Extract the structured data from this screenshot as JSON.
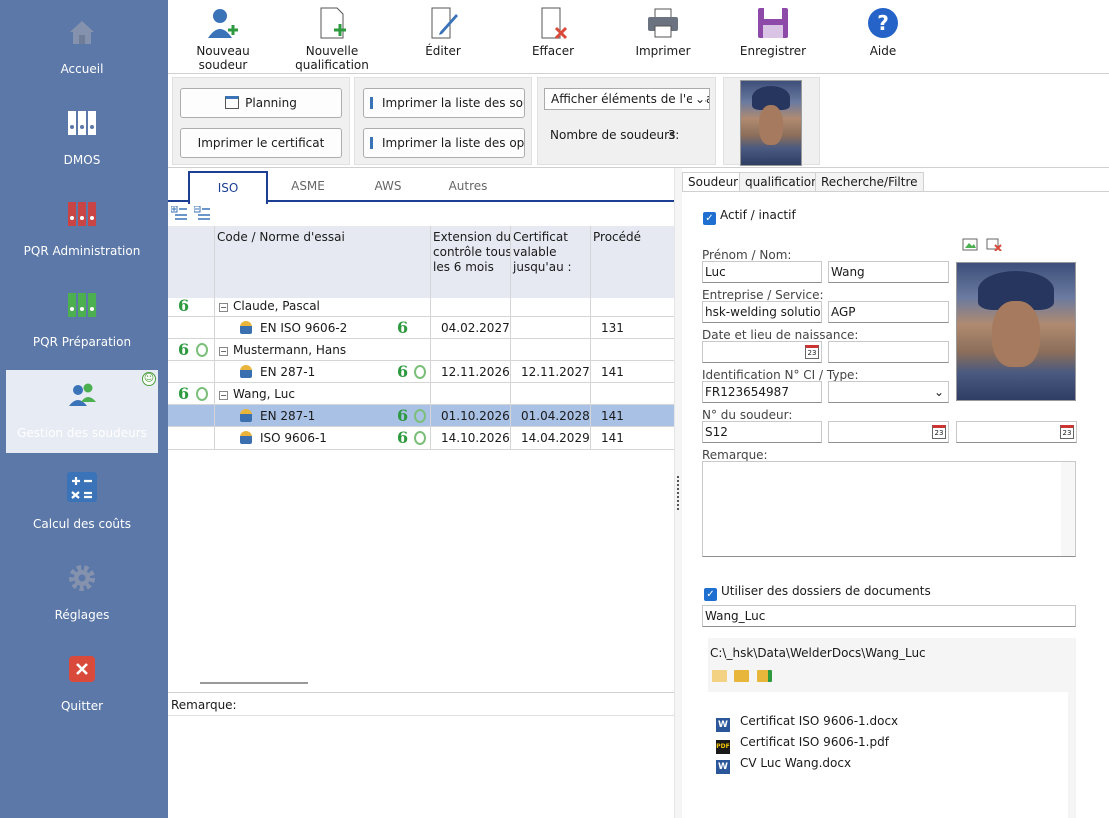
{
  "sidebar": {
    "items": [
      {
        "label": "Accueil",
        "icon": "home-icon"
      },
      {
        "label": "DMOS",
        "icon": "binders-icon"
      },
      {
        "label": "PQR Administration",
        "icon": "binders-red-icon"
      },
      {
        "label": "PQR Préparation",
        "icon": "binders-green-icon"
      },
      {
        "label": "Gestion des soudeurs",
        "icon": "welders-icon"
      },
      {
        "label": "Calcul des coûts",
        "icon": "calculator-icon"
      },
      {
        "label": "Réglages",
        "icon": "gear-icon"
      },
      {
        "label": "Quitter",
        "icon": "close-icon"
      }
    ],
    "smiley": "☺"
  },
  "toolbar": {
    "new_welder": "Nouveau soudeur",
    "new_qual_1": "Nouvelle",
    "new_qual_2": "qualification",
    "edit": "Éditer",
    "delete": "Effacer",
    "print": "Imprimer",
    "save": "Enregistrer",
    "help": "Aide"
  },
  "subbar": {
    "planning": "Planning",
    "print_certificate": "Imprimer le certificat",
    "print_welder_list": "Imprimer la liste des soudeurs",
    "print_operator_list": "Imprimer la liste des opérateurs",
    "show_elements": "Afficher éléments de l'essai",
    "welder_count_label": "Nombre de soudeurs:",
    "welder_count": "3"
  },
  "tabs": [
    "ISO",
    "ASME",
    "AWS",
    "Autres"
  ],
  "table": {
    "headers": {
      "code": "Code / Norme d'essai",
      "ext_1": "Extension du",
      "ext_2": "contrôle tous",
      "ext_3": "les 6 mois",
      "cert_1": "Certificat",
      "cert_2": "valable",
      "cert_3": "jusqu'au :",
      "process": "Procédé"
    },
    "six": "6",
    "groups": [
      {
        "name": "Claude, Pascal",
        "rows": [
          {
            "code": "EN ISO 9606-2",
            "ext": "04.02.2027",
            "cert": "",
            "proc": "131"
          }
        ]
      },
      {
        "name": "Mustermann, Hans",
        "rows": [
          {
            "code": "EN 287-1",
            "ext": "12.11.2026",
            "cert": "12.11.2027",
            "proc": "141"
          }
        ]
      },
      {
        "name": "Wang, Luc",
        "rows": [
          {
            "code": "EN 287-1",
            "ext": "01.10.2026",
            "cert": "01.04.2028",
            "proc": "141"
          },
          {
            "code": "ISO 9606-1",
            "ext": "14.10.2026",
            "cert": "14.04.2029",
            "proc": "141"
          }
        ]
      }
    ]
  },
  "left_remark_label": "Remarque:",
  "right": {
    "tabs": [
      "Soudeur",
      "qualification",
      "Recherche/Filtre"
    ],
    "active_label": "Actif / inactif",
    "name_label": "Prénom / Nom:",
    "first_name": "Luc",
    "last_name": "Wang",
    "company_label": "Entreprise / Service:",
    "company": "hsk-welding solutions",
    "service": "AGP",
    "birth_label": "Date et lieu de naissance:",
    "id_label": "Identification N° CI / Type:",
    "id_value": "FR123654987",
    "welder_no_label": "N° du soudeur:",
    "welder_no": "S12",
    "remark_label": "Remarque:",
    "use_docs_label": "Utiliser des dossiers de documents",
    "docs_folder": "Wang_Luc",
    "docs_path": "C:\\_hsk\\Data\\WelderDocs\\Wang_Luc",
    "cal_glyph": "23",
    "files": [
      {
        "name": "Certificat ISO 9606-1.docx",
        "type": "word"
      },
      {
        "name": "Certificat ISO 9606-1.pdf",
        "type": "pdf"
      },
      {
        "name": "CV Luc Wang.docx",
        "type": "word"
      }
    ],
    "word_glyph": "W",
    "pdf_glyph": "PDF"
  }
}
